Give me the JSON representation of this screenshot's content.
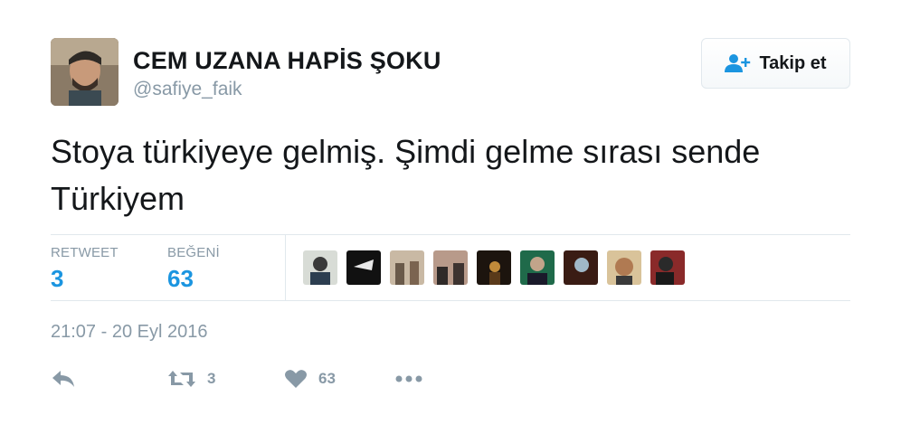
{
  "user": {
    "display_name": "CEM UZANA HAPİS ŞOKU",
    "screen_name": "@safiye_faik",
    "avatar_icon": "profile-photo"
  },
  "follow_button": {
    "label": "Takip et",
    "icon": "add-user-icon"
  },
  "tweet": {
    "text": "Stoya türkiyeye gelmiş. Şimdi gelme sırası sende Türkiyem",
    "timestamp": "21:07 - 20 Eyl 2016"
  },
  "stats": {
    "retweet_label": "RETWEET",
    "retweet_count": "3",
    "like_label": "BEĞENİ",
    "like_count": "63"
  },
  "likers": [
    {
      "icon": "user-avatar"
    },
    {
      "icon": "user-avatar"
    },
    {
      "icon": "user-avatar"
    },
    {
      "icon": "user-avatar"
    },
    {
      "icon": "user-avatar"
    },
    {
      "icon": "user-avatar"
    },
    {
      "icon": "user-avatar"
    },
    {
      "icon": "user-avatar"
    },
    {
      "icon": "user-avatar"
    }
  ],
  "actions": {
    "reply_icon": "reply-icon",
    "retweet_icon": "retweet-icon",
    "retweet_count": "3",
    "like_icon": "heart-icon",
    "like_count": "63",
    "more_icon": "more-icon"
  },
  "colors": {
    "accent": "#1b95e0",
    "muted": "#8899a6",
    "text": "#14171a",
    "border": "#e1e8ed"
  }
}
